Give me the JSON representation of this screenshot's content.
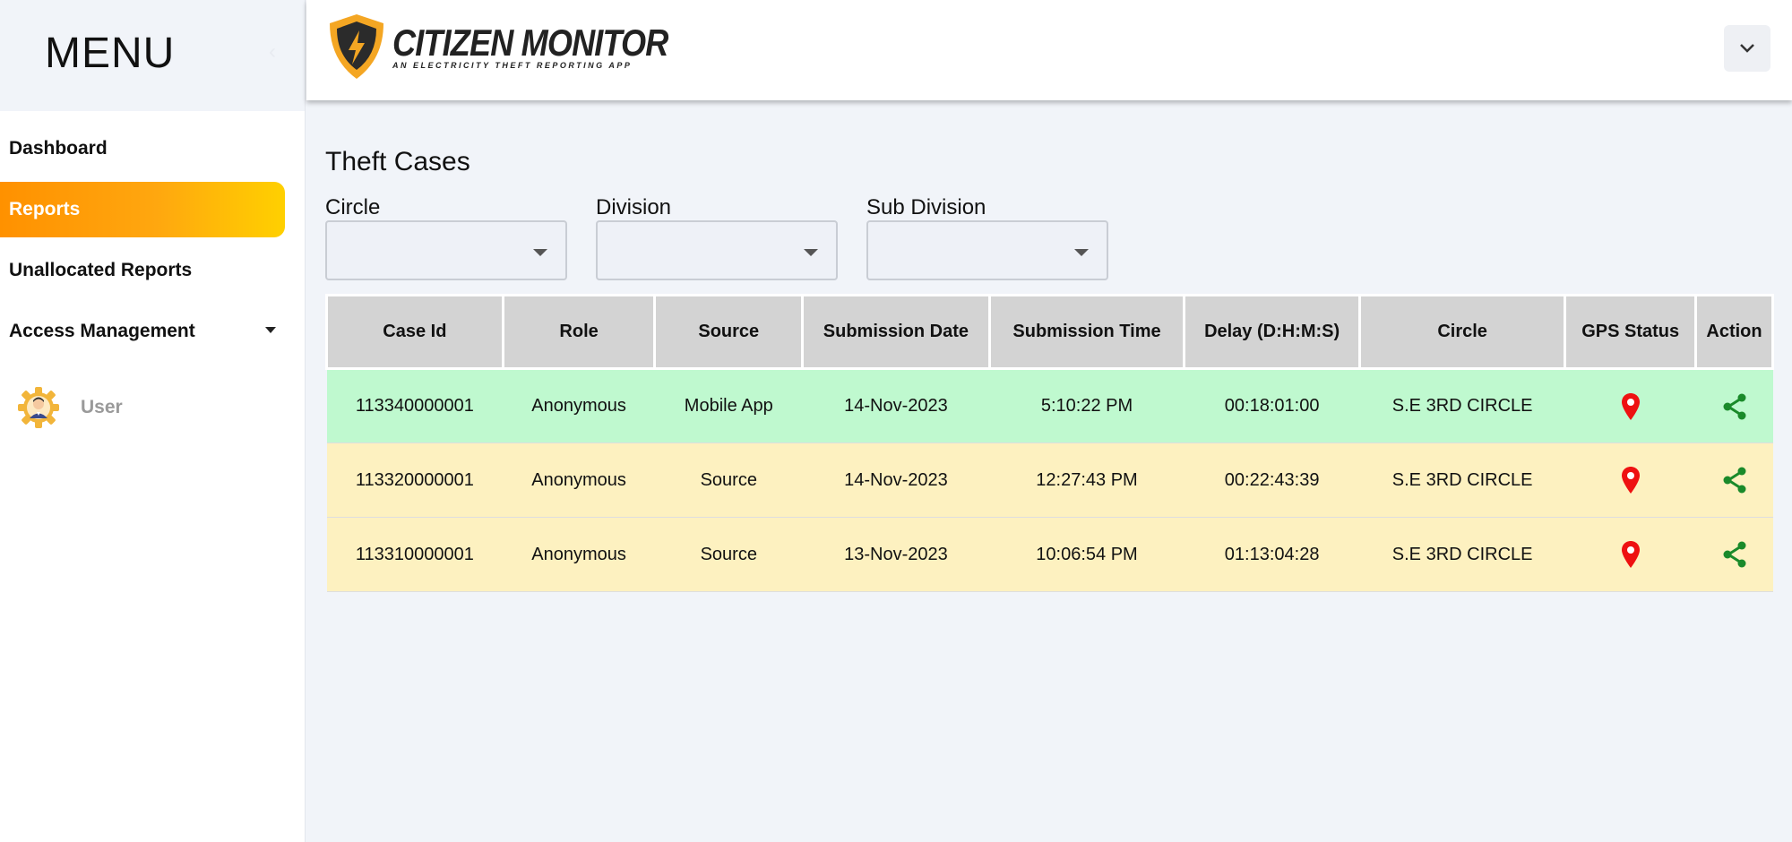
{
  "sidebar": {
    "menu_title": "MENU",
    "collapse_icon": "chevron-left-icon",
    "items": [
      {
        "label": "Dashboard",
        "active": false
      },
      {
        "label": "Reports",
        "active": true
      },
      {
        "label": "Unallocated Reports",
        "active": false
      },
      {
        "label": "Access Management",
        "active": false,
        "has_dropdown": true
      }
    ],
    "user": {
      "label": "User",
      "icon": "user-gear-avatar"
    }
  },
  "header": {
    "logo_name": "CITIZEN MONITOR",
    "logo_tagline": "AN ELECTRICITY THEFT REPORTING APP",
    "dropdown_icon": "chevron-down-icon"
  },
  "main": {
    "title": "Theft Cases",
    "filters": [
      {
        "label": "Circle",
        "value": ""
      },
      {
        "label": "Division",
        "value": ""
      },
      {
        "label": "Sub Division",
        "value": ""
      }
    ],
    "table": {
      "columns": [
        "Case Id",
        "Role",
        "Source",
        "Submission Date",
        "Submission Time",
        "Delay (D:H:M:S)",
        "Circle",
        "GPS Status",
        "Action"
      ],
      "rows": [
        {
          "case_id": "113340000001",
          "role": "Anonymous",
          "source": "Mobile App",
          "date": "14-Nov-2023",
          "time": "5:10:22 PM",
          "delay": "00:18:01:00",
          "circle": "S.E 3RD CIRCLE",
          "status_color": "#bff9cf"
        },
        {
          "case_id": "113320000001",
          "role": "Anonymous",
          "source": "Source",
          "date": "14-Nov-2023",
          "time": "12:27:43 PM",
          "delay": "00:22:43:39",
          "circle": "S.E 3RD CIRCLE",
          "status_color": "#fdf1c0"
        },
        {
          "case_id": "113310000001",
          "role": "Anonymous",
          "source": "Source",
          "date": "13-Nov-2023",
          "time": "10:06:54 PM",
          "delay": "01:13:04:28",
          "circle": "S.E 3RD CIRCLE",
          "status_color": "#fdf1c0"
        }
      ]
    }
  },
  "colors": {
    "active_gradient_start": "#ff9100",
    "active_gradient_end": "#ffd000",
    "gps_pin": "#ee1111",
    "share_icon": "#1a8a2a"
  }
}
